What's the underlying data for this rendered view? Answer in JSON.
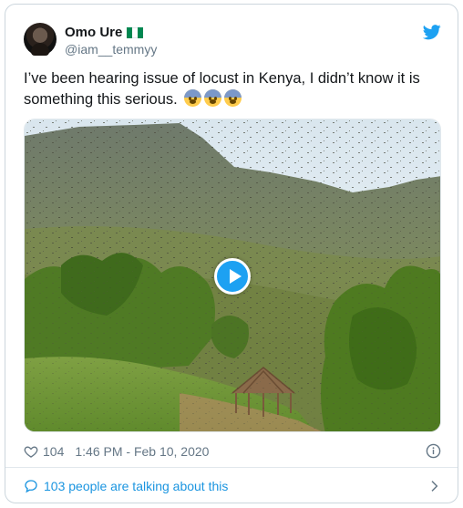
{
  "tweet": {
    "display_name": "Omo Ure",
    "handle": "@iam__temmyy",
    "flag_icon": "nigeria-flag-icon",
    "text": "I’ve been hearing issue of locust in Kenya, I didn’t know it is something this serious.",
    "emoji_icon": "anxious-face-with-sweat-icon",
    "emoji_count": 3
  },
  "media": {
    "type": "video",
    "play_icon": "play-icon"
  },
  "meta": {
    "likes": "104",
    "timestamp": "1:46 PM - Feb 10, 2020"
  },
  "footer": {
    "conversation_label": "103 people are talking about this"
  },
  "colors": {
    "brand_blue": "#1da1f2",
    "link_blue": "#1b95e0",
    "secondary_text": "#657786",
    "border": "#ccd6dd"
  }
}
